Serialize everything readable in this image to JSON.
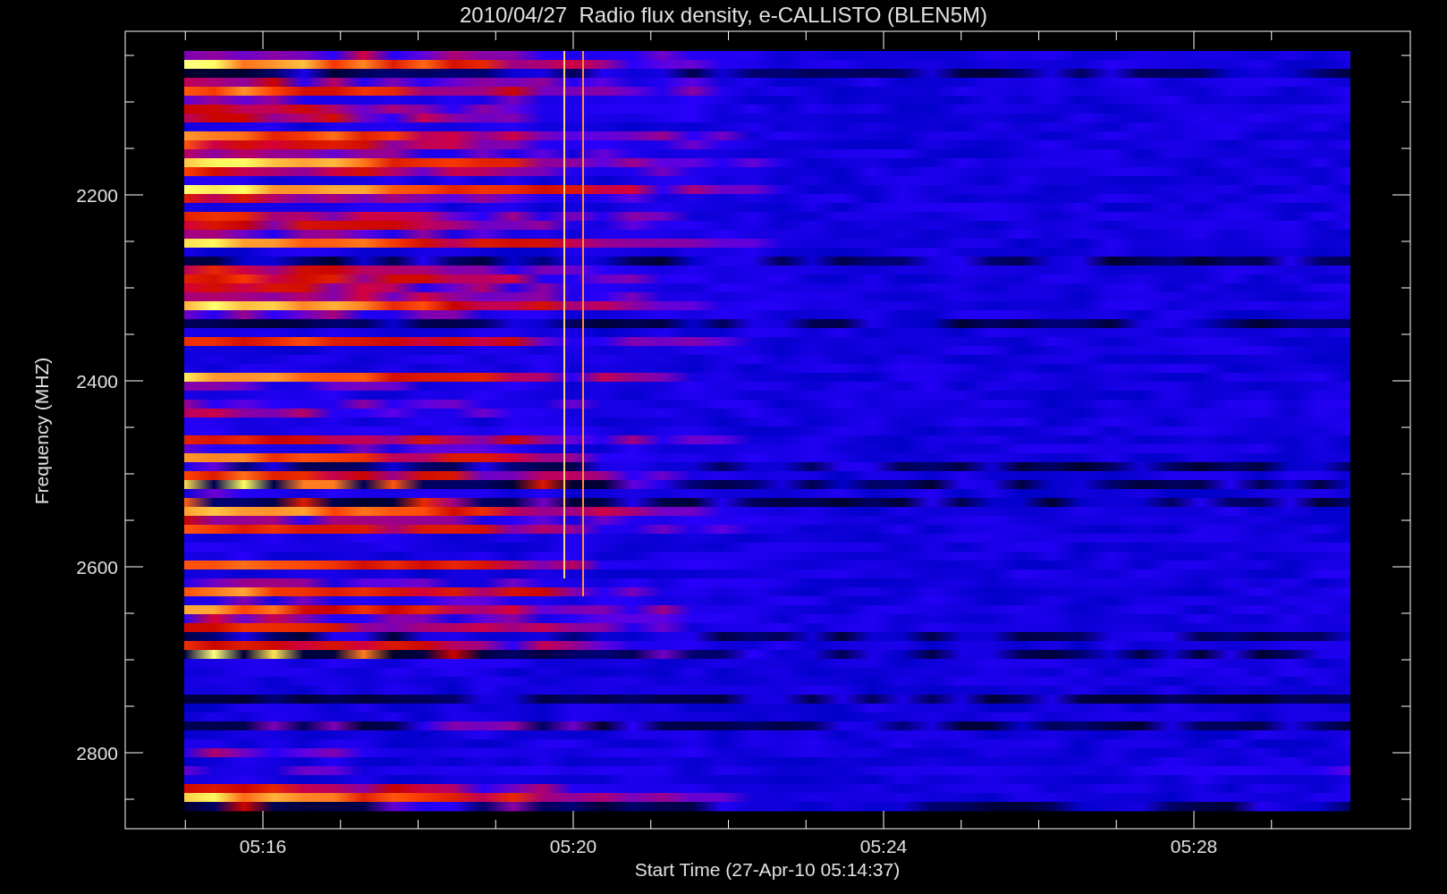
{
  "title": "2010/04/27  Radio flux density, e-CALLISTO (BLEN5M)",
  "x_axis": {
    "label": "Start Time (27-Apr-10 05:14:37)",
    "ticks": [
      "05:16",
      "05:20",
      "05:24",
      "05:28"
    ]
  },
  "y_axis": {
    "label": "Frequency (MHZ)",
    "ticks": [
      "2200",
      "2400",
      "2600",
      "2800"
    ]
  }
}
